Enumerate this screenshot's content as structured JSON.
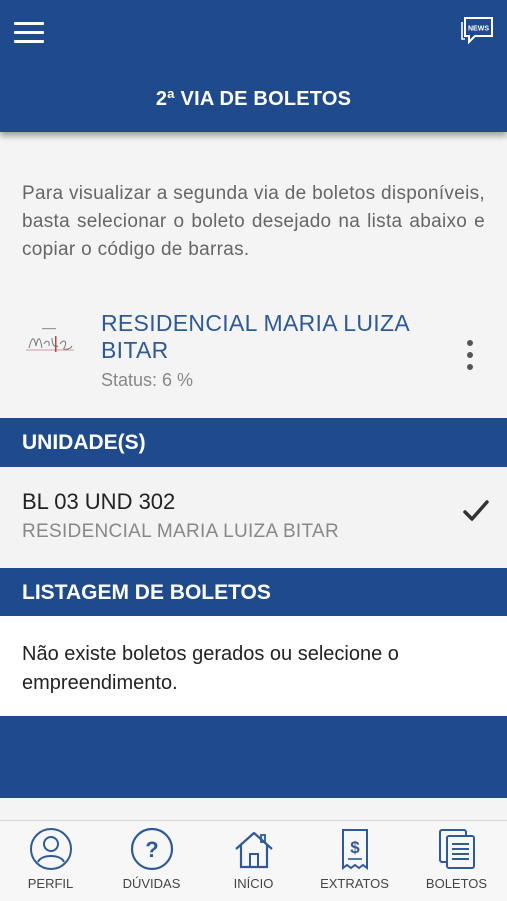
{
  "header": {
    "title": "2ª VIA DE BOLETOS",
    "news_label": "NEWS"
  },
  "intro_text": "Para visualizar a segunda via de boletos disponíveis, basta selecionar o boleto desejado na lista abaixo e copiar o código de barras.",
  "empreendimento": {
    "name": "RESIDENCIAL MARIA LUIZA BITAR",
    "status": "Status: 6 %",
    "logo_icon": "residencial-logo"
  },
  "units_section": {
    "title": "UNIDADE(S)",
    "items": [
      {
        "code": "BL 03 UND 302",
        "empreendimento": "RESIDENCIAL MARIA LUIZA BITAR",
        "selected": true
      }
    ]
  },
  "boletos_section": {
    "title": "LISTAGEM DE BOLETOS",
    "empty_message": "Não existe boletos gerados ou selecione o empreendimento."
  },
  "tabbar": {
    "items": [
      {
        "label": "PERFIL",
        "icon": "user-icon"
      },
      {
        "label": "DÚVIDAS",
        "icon": "question-icon"
      },
      {
        "label": "INÍCIO",
        "icon": "home-icon"
      },
      {
        "label": "EXTRATOS",
        "icon": "receipt-icon"
      },
      {
        "label": "BOLETOS",
        "icon": "documents-icon"
      }
    ]
  },
  "colors": {
    "primary": "#1f4a8c",
    "accent_text": "#2f5a96",
    "icon_blue": "#2f5a96"
  }
}
